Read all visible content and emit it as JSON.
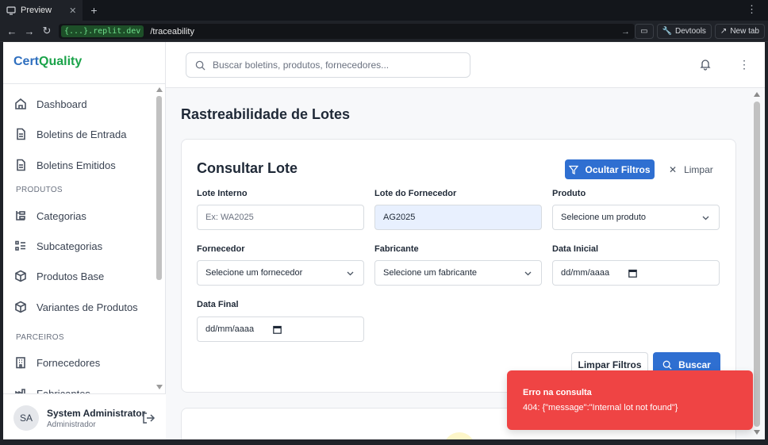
{
  "browser": {
    "tab_title": "Preview",
    "url_host": "{...}.replit.dev",
    "url_path": "/traceability",
    "devtools_label": "Devtools",
    "newtab_label": "New tab"
  },
  "sidebar": {
    "brand_part1": "Cert",
    "brand_part2": "Quality",
    "items": [
      {
        "label": "Dashboard",
        "icon": "home-icon"
      },
      {
        "label": "Boletins de Entrada",
        "icon": "file-icon"
      },
      {
        "label": "Boletins Emitidos",
        "icon": "file-icon"
      }
    ],
    "section_produtos": "PRODUTOS",
    "produtos_items": [
      {
        "label": "Categorias",
        "icon": "category-icon"
      },
      {
        "label": "Subcategorias",
        "icon": "list-icon"
      },
      {
        "label": "Produtos Base",
        "icon": "box-icon"
      },
      {
        "label": "Variantes de Produtos",
        "icon": "box-icon"
      }
    ],
    "section_parceiros": "PARCEIROS",
    "parceiros_items": [
      {
        "label": "Fornecedores",
        "icon": "building-icon"
      },
      {
        "label": "Fabricantes",
        "icon": "factory-icon"
      }
    ],
    "user": {
      "initials": "SA",
      "name": "System Administrator",
      "role": "Administrador"
    }
  },
  "header": {
    "search_placeholder": "Buscar boletins, produtos, fornecedores..."
  },
  "main": {
    "page_title": "Rastreabilidade de Lotes",
    "card_title": "Consultar Lote",
    "hide_filters_label": "Ocultar Filtros",
    "clear_label": "Limpar",
    "fields": {
      "lote_interno": {
        "label": "Lote Interno",
        "placeholder": "Ex: WA2025"
      },
      "lote_fornecedor": {
        "label": "Lote do Fornecedor",
        "value": "AG2025"
      },
      "produto": {
        "label": "Produto",
        "value": "Selecione um produto"
      },
      "fornecedor": {
        "label": "Fornecedor",
        "value": "Selecione um fornecedor"
      },
      "fabricante": {
        "label": "Fabricante",
        "value": "Selecione um fabricante"
      },
      "data_inicial": {
        "label": "Data Inicial",
        "value": "dd/mm/aaaa"
      },
      "data_final": {
        "label": "Data Final",
        "value": "dd/mm/aaaa"
      }
    },
    "clear_filters_label": "Limpar Filtros",
    "search_label": "Buscar"
  },
  "toast": {
    "title": "Erro na consulta",
    "message": "404: {\"message\":\"Internal lot not found\"}"
  },
  "colors": {
    "primary": "#2f6fd1",
    "brand_blue": "#2f6fbf",
    "brand_green": "#1ba34a",
    "error": "#ef4444",
    "filled_field": "#e8f0fe"
  }
}
